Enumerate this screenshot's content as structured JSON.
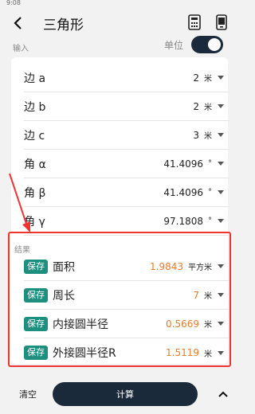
{
  "status_bar": {
    "time": "9:08"
  },
  "app_bar": {
    "title": "三角形"
  },
  "input_section": {
    "label": "输入",
    "unit_toggle_label": "单位",
    "unit_toggle_on": true,
    "rows": [
      {
        "label": "边 a",
        "value": "2",
        "unit": "米"
      },
      {
        "label": "边 b",
        "value": "2",
        "unit": "米"
      },
      {
        "label": "边 c",
        "value": "3",
        "unit": "米"
      },
      {
        "label": "角 α",
        "value": "41.4096",
        "unit": "°"
      },
      {
        "label": "角 β",
        "value": "41.4096",
        "unit": "°"
      },
      {
        "label": "角 γ",
        "value": "97.1808",
        "unit": "°"
      }
    ]
  },
  "results_section": {
    "label": "结果",
    "save_label": "保存",
    "rows": [
      {
        "label": "面积",
        "value": "1.9843",
        "unit": "平方米"
      },
      {
        "label": "周长",
        "value": "7",
        "unit": "米"
      },
      {
        "label": "内接圆半径",
        "value": "0.5669",
        "unit": "米"
      },
      {
        "label": "外接圆半径R",
        "value": "1.5119",
        "unit": "米"
      }
    ]
  },
  "bottom_bar": {
    "clear_label": "清空",
    "calculate_label": "计算"
  },
  "colors": {
    "accent_dark": "#1b2a3a",
    "save_green": "#1d8f7f",
    "result_orange": "#ea7a2b",
    "annotation_red": "#e33333"
  },
  "icons": {
    "back": "arrow-left-icon",
    "calculator": "calculator-icon",
    "phone": "phone-icon",
    "dropdown": "caret-down-icon",
    "expand": "chevron-up-icon"
  }
}
